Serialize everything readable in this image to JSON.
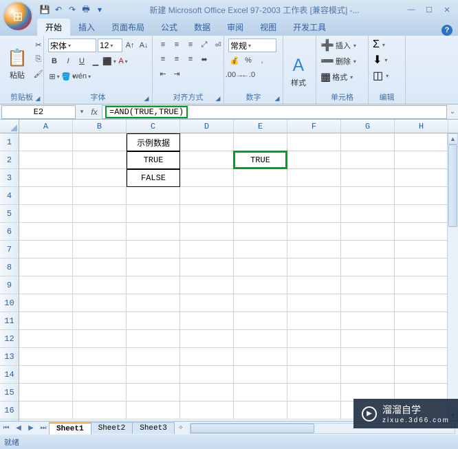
{
  "window": {
    "title": "新建 Microsoft Office Excel 97-2003 工作表 [兼容模式] -..."
  },
  "tabs": {
    "home": "开始",
    "insert": "插入",
    "layout": "页面布局",
    "formulas": "公式",
    "data": "数据",
    "review": "审阅",
    "view": "视图",
    "dev": "开发工具"
  },
  "ribbon": {
    "clipboard": {
      "label": "剪贴板",
      "paste": "粘贴"
    },
    "font": {
      "label": "字体",
      "name": "宋体",
      "size": "12",
      "bold": "B",
      "italic": "I",
      "underline": "U"
    },
    "alignment": {
      "label": "对齐方式"
    },
    "number": {
      "label": "数字",
      "format": "常规",
      "percent": "%"
    },
    "styles": {
      "label": "样式"
    },
    "cells": {
      "label": "单元格",
      "insert": "插入",
      "delete": "删除",
      "format": "格式"
    },
    "editing": {
      "label": "编辑",
      "sigma": "Σ"
    }
  },
  "formula_bar": {
    "name_box": "E2",
    "fx": "fx",
    "formula": "=AND(TRUE,TRUE)"
  },
  "columns": [
    "A",
    "B",
    "C",
    "D",
    "E",
    "F",
    "G",
    "H"
  ],
  "rows": [
    "1",
    "2",
    "3",
    "4",
    "5",
    "6",
    "7",
    "8",
    "9",
    "10",
    "11",
    "12",
    "13",
    "14",
    "15",
    "16"
  ],
  "cells": {
    "C1": "示例数据",
    "C2": "TRUE",
    "C3": "FALSE",
    "E2": "TRUE"
  },
  "sheets": {
    "s1": "Sheet1",
    "s2": "Sheet2",
    "s3": "Sheet3"
  },
  "status": {
    "ready": "就绪"
  },
  "watermark": {
    "brand": "溜溜自学",
    "url": "zixue.3d66.com"
  },
  "chart_data": {
    "type": "table",
    "title": "示例数据",
    "categories": [
      "C2",
      "C3"
    ],
    "values": [
      "TRUE",
      "FALSE"
    ],
    "formula_cell": "E2",
    "formula": "=AND(TRUE,TRUE)",
    "formula_result": "TRUE"
  }
}
